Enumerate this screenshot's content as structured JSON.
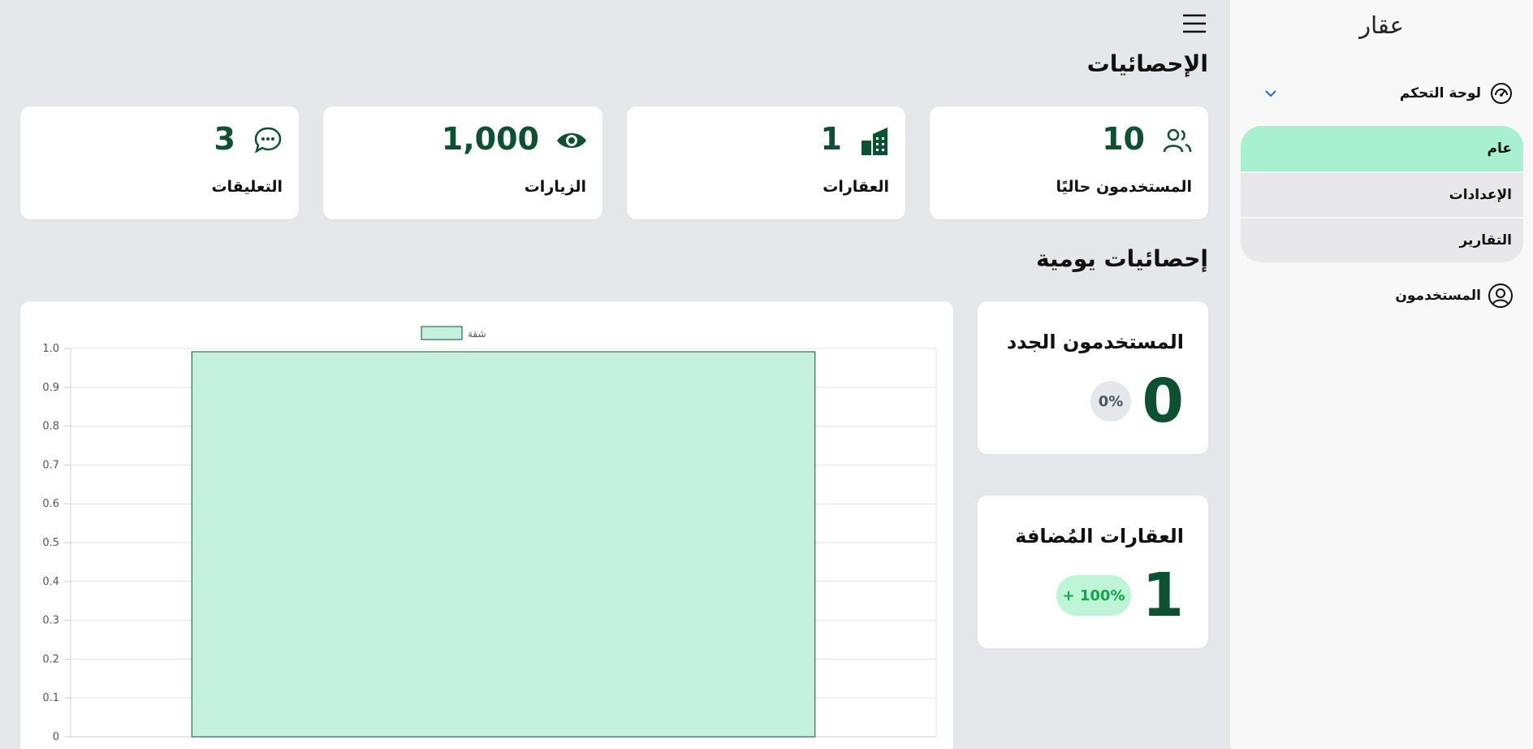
{
  "sidebar": {
    "brand": "عقار",
    "dashboard_label": "لوحة التحكم",
    "submenu": [
      {
        "label": "عام",
        "active": true
      },
      {
        "label": "الإعدادات",
        "active": false
      },
      {
        "label": "التقارير",
        "active": false
      }
    ],
    "users_label": "المستخدمون"
  },
  "main": {
    "statistics_title": "الإحصائيات",
    "stats": [
      {
        "value": "10",
        "label": "المستخدمون حاليًا",
        "icon": "users-icon"
      },
      {
        "value": "1",
        "label": "العقارات",
        "icon": "buildings-icon"
      },
      {
        "value": "1,000",
        "label": "الزيارات",
        "icon": "eye-icon"
      },
      {
        "value": "3",
        "label": "التعليقات",
        "icon": "chat-icon"
      }
    ],
    "daily_title": "إحصائيات يومية",
    "new_users": {
      "title": "المستخدمون الجدد",
      "value": "0",
      "change": "0%"
    },
    "added_properties": {
      "title": "العقارات المُضافة",
      "value": "1",
      "change": "+ 100%"
    }
  },
  "colors": {
    "accent_dark": "#0b5132",
    "active_menu": "#a8f0cf",
    "bar_fill": "#c4f0de",
    "bar_border": "#0b5132",
    "positive_pill_bg": "#bdf5d6",
    "positive_pill_text": "#16a34a",
    "neutral_pill_bg": "#e6e7ea"
  },
  "chart_data": {
    "type": "bar",
    "categories": [
      ""
    ],
    "series": [
      {
        "name": "شقة",
        "values": [
          1.0
        ]
      }
    ],
    "ylim": [
      0,
      1.0
    ],
    "yticks": [
      "0",
      "0.1",
      "0.2",
      "0.3",
      "0.4",
      "0.5",
      "0.6",
      "0.7",
      "0.8",
      "0.9",
      "1.0"
    ],
    "grid": true,
    "legend": "top-center"
  }
}
